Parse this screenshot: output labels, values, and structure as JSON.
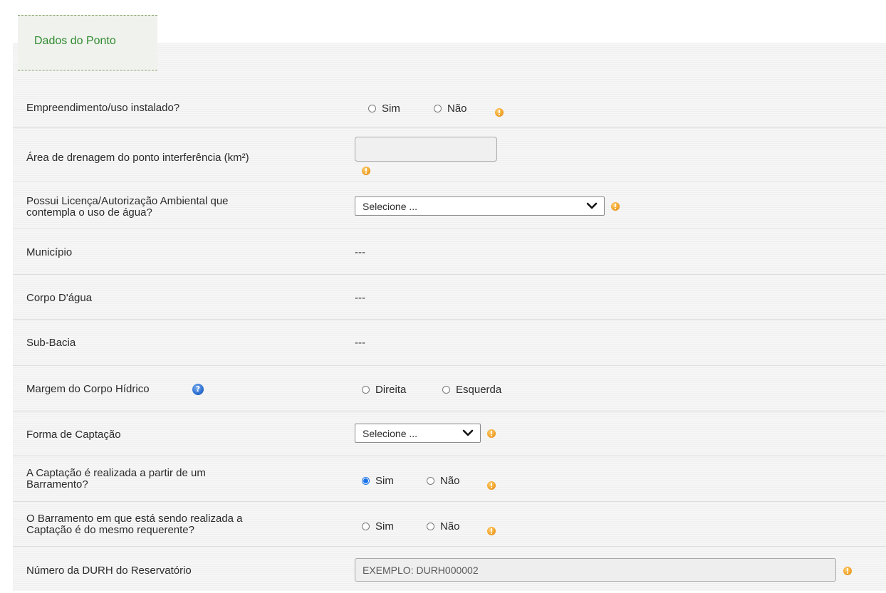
{
  "tab": {
    "title": "Dados do Ponto"
  },
  "rows": {
    "empreendimento": {
      "label": "Empreendimento/uso instalado?",
      "options": [
        "Sim",
        "Não"
      ],
      "selected": null
    },
    "area": {
      "label": "Área de drenagem do ponto interferência (km²)",
      "value": ""
    },
    "licenca": {
      "label_line1": "Possui Licença/Autorização Ambiental que",
      "label_line2": "contempla o uso de água?",
      "selected": "Selecione ..."
    },
    "municipio": {
      "label": "Município",
      "value": "---"
    },
    "corpo": {
      "label": "Corpo D'água",
      "value": "---"
    },
    "subbacia": {
      "label": "Sub-Bacia",
      "value": "---"
    },
    "margem": {
      "label": "Margem do Corpo Hídrico",
      "help_icon": "help-icon",
      "options": [
        "Direita",
        "Esquerda"
      ],
      "selected": null
    },
    "forma": {
      "label": "Forma de Captação",
      "selected": "Selecione ..."
    },
    "barramento": {
      "label_line1": "A Captação é realizada a partir de um",
      "label_line2": "Barramento?",
      "options": [
        "Sim",
        "Não"
      ],
      "selected": "Sim"
    },
    "mesmo": {
      "label_line1": "O Barramento em que está sendo realizada a",
      "label_line2": "Captação é do mesmo requerente?",
      "options": [
        "Sim",
        "Não"
      ],
      "selected": null
    },
    "durh": {
      "label": "Número da DURH do Reservatório",
      "placeholder": "EXEMPLO: DURH000002"
    }
  },
  "icons": {
    "warning": "warning-icon",
    "help": "question-icon",
    "dropdown": "chevron-down-icon"
  },
  "colors": {
    "tab_text": "#2f8a2f",
    "radio_checked": "#1a73e8",
    "warning": "#f2a52c",
    "help": "#2b6fd1"
  }
}
